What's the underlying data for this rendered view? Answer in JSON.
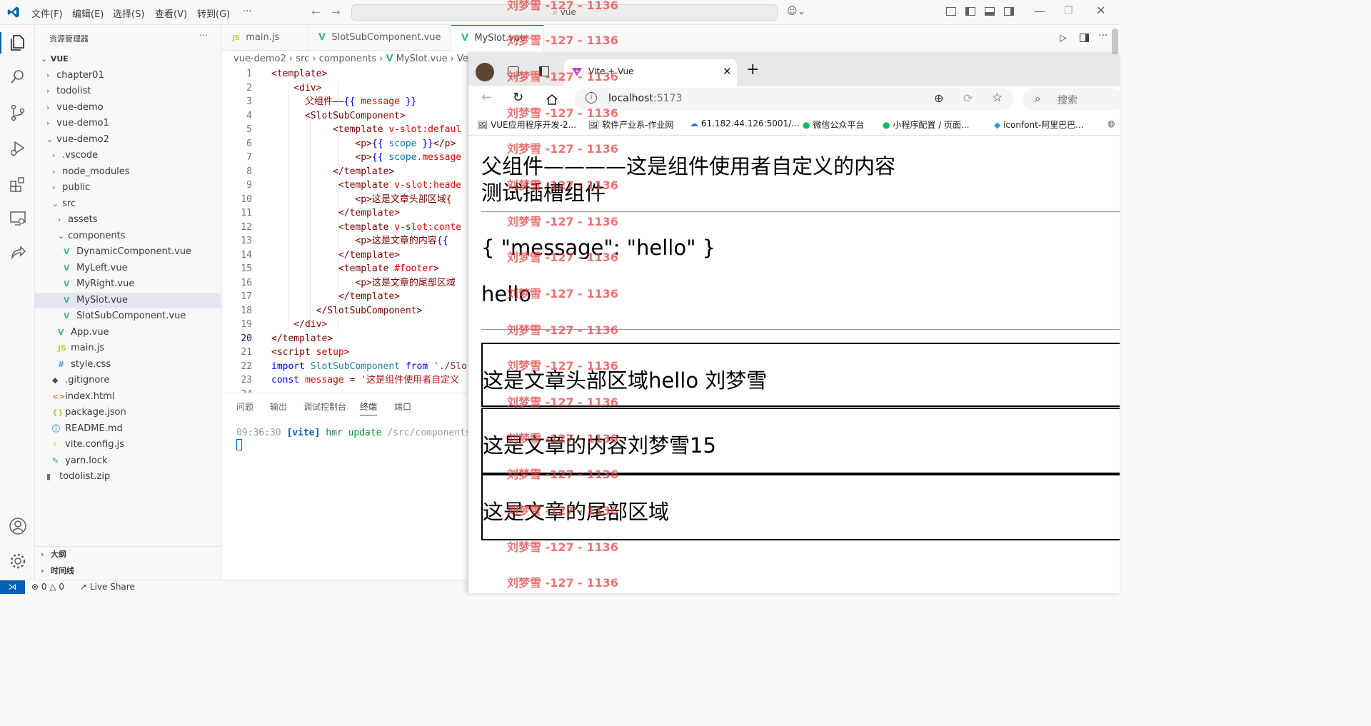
{
  "vscode": {
    "menu": [
      "文件(F)",
      "编辑(E)",
      "选择(S)",
      "查看(V)",
      "转到(G)",
      "···"
    ],
    "search_text": "vue",
    "explorer_title": "资源管理器",
    "explorer_more": "···",
    "tree": [
      {
        "label": "VUE",
        "depth": 0,
        "kind": "root-open"
      },
      {
        "label": "chapter01",
        "depth": 1,
        "kind": "folder"
      },
      {
        "label": "todolist",
        "depth": 1,
        "kind": "folder"
      },
      {
        "label": "vue-demo",
        "depth": 1,
        "kind": "folder"
      },
      {
        "label": "vue-demo1",
        "depth": 1,
        "kind": "folder"
      },
      {
        "label": "vue-demo2",
        "depth": 1,
        "kind": "folder-open"
      },
      {
        "label": ".vscode",
        "depth": 2,
        "kind": "folder"
      },
      {
        "label": "node_modules",
        "depth": 2,
        "kind": "folder"
      },
      {
        "label": "public",
        "depth": 2,
        "kind": "folder"
      },
      {
        "label": "src",
        "depth": 2,
        "kind": "folder-open"
      },
      {
        "label": "assets",
        "depth": 3,
        "kind": "folder"
      },
      {
        "label": "components",
        "depth": 3,
        "kind": "folder-open"
      },
      {
        "label": "DynamicComponent.vue",
        "depth": 4,
        "kind": "vue"
      },
      {
        "label": "MyLeft.vue",
        "depth": 4,
        "kind": "vue"
      },
      {
        "label": "MyRight.vue",
        "depth": 4,
        "kind": "vue"
      },
      {
        "label": "MySlot.vue",
        "depth": 4,
        "kind": "vue",
        "selected": true
      },
      {
        "label": "SlotSubComponent.vue",
        "depth": 4,
        "kind": "vue"
      },
      {
        "label": "App.vue",
        "depth": 3,
        "kind": "vue"
      },
      {
        "label": "main.js",
        "depth": 3,
        "kind": "js"
      },
      {
        "label": "style.css",
        "depth": 3,
        "kind": "css"
      },
      {
        "label": ".gitignore",
        "depth": 2,
        "kind": "git"
      },
      {
        "label": "index.html",
        "depth": 2,
        "kind": "html"
      },
      {
        "label": "package.json",
        "depth": 2,
        "kind": "json"
      },
      {
        "label": "README.md",
        "depth": 2,
        "kind": "info"
      },
      {
        "label": "vite.config.js",
        "depth": 2,
        "kind": "vite"
      },
      {
        "label": "yarn.lock",
        "depth": 2,
        "kind": "yarn"
      },
      {
        "label": "todolist.zip",
        "depth": 1,
        "kind": "zip"
      }
    ],
    "outline_label": "大纲",
    "timeline_label": "时间线",
    "tabs": [
      {
        "icon": "JS",
        "label": "main.js"
      },
      {
        "icon": "V",
        "label": "SlotSubComponent.vue"
      },
      {
        "icon": "V",
        "label": "MySlot.vue"
      }
    ],
    "breadcrumb": [
      "vue-demo2",
      "src",
      "components",
      "MySlot.vue",
      "Vet"
    ],
    "code_lines": [
      {
        "n": "1",
        "t": "<template>"
      },
      {
        "n": "2",
        "t": "    <div>"
      },
      {
        "n": "3",
        "t": "      父组件——{{ message }}"
      },
      {
        "n": "4",
        "t": "      <SlotSubComponent>"
      },
      {
        "n": "5",
        "t": "           <template v-slot:defaul"
      },
      {
        "n": "6",
        "t": "               <p>{{ scope }}</p>"
      },
      {
        "n": "7",
        "t": "               <p>{{ scope.message"
      },
      {
        "n": "8",
        "t": "           </template>"
      },
      {
        "n": "9",
        "t": "            <template v-slot:heade"
      },
      {
        "n": "10",
        "t": "               <p>这是文章头部区域{"
      },
      {
        "n": "11",
        "t": "            </template>"
      },
      {
        "n": "12",
        "t": "            <template v-slot:conte"
      },
      {
        "n": "13",
        "t": "               <p>这是文章的内容{{"
      },
      {
        "n": "14",
        "t": "            </template>"
      },
      {
        "n": "15",
        "t": "            <template #footer>"
      },
      {
        "n": "16",
        "t": "               <p>这是文章的尾部区域"
      },
      {
        "n": "17",
        "t": "            </template>"
      },
      {
        "n": "18",
        "t": "        </SlotSubComponent>"
      },
      {
        "n": "19",
        "t": "    </div>"
      },
      {
        "n": "20",
        "t": "</template>"
      },
      {
        "n": "21",
        "t": "<script setup>"
      },
      {
        "n": "22",
        "t": "import SlotSubComponent from './Slo"
      },
      {
        "n": "23",
        "t": "const message = '这是组件使用者自定义"
      },
      {
        "n": "24",
        "t": ""
      }
    ],
    "panel_tabs": [
      "问题",
      "输出",
      "调试控制台",
      "终端",
      "端口"
    ],
    "terminal": {
      "time": "09:36:30",
      "tag": "[vite]",
      "msg": "hmr update",
      "path": "/src/components/M"
    },
    "status": {
      "errors": "0",
      "warnings": "0",
      "live_share": "Live Share"
    }
  },
  "browser": {
    "tab_title": "Vite + Vue",
    "url_host": "localhost",
    "url_port": ":5173",
    "search_placeholder": "搜索",
    "bookmarks": [
      "VUE应用程序开发-2...",
      "软件产业系-作业网",
      "61.182.44.126:5001/...",
      "微信公众平台",
      "小程序配置 / 页面...",
      "iconfont-阿里巴巴..."
    ],
    "page": {
      "line1": "父组件————这是组件使用者自定义的内容",
      "line2": "测试插槽组件",
      "scope_json": "{ \"message\": \"hello\" }",
      "scope_message": "hello",
      "header_slot": "这是文章头部区域hello 刘梦雪",
      "content_slot": "这是文章的内容刘梦雪15",
      "footer_slot": "这是文章的尾部区域"
    }
  },
  "watermark": "刘梦雪 -127 - 1136",
  "colors": {
    "vscode_accent": "#005fb8",
    "vue_green": "#41b883",
    "watermark_red": "#eb3c3c"
  }
}
